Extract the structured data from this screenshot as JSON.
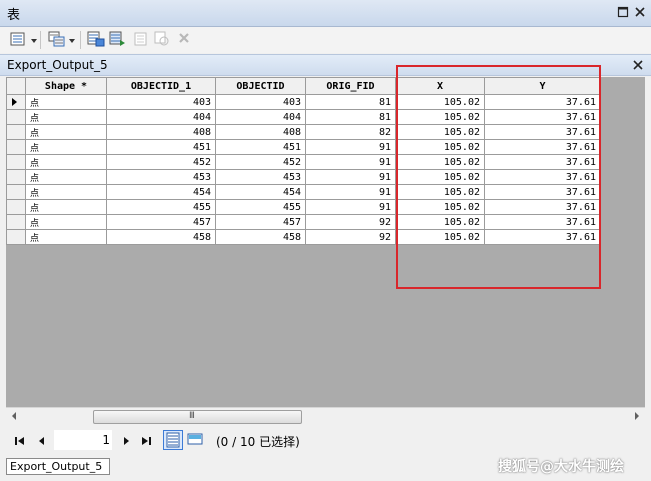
{
  "window": {
    "title": "表"
  },
  "table_tab": {
    "name": "Export_Output_5"
  },
  "table": {
    "columns": [
      "Shape *",
      "OBJECTID_1",
      "OBJECTID",
      "ORIG_FID",
      "X",
      "Y"
    ],
    "rows": [
      {
        "shape": "点",
        "objectid_1": "403",
        "objectid": "403",
        "orig_fid": "81",
        "x": "105.02",
        "y": "37.61"
      },
      {
        "shape": "点",
        "objectid_1": "404",
        "objectid": "404",
        "orig_fid": "81",
        "x": "105.02",
        "y": "37.61"
      },
      {
        "shape": "点",
        "objectid_1": "408",
        "objectid": "408",
        "orig_fid": "82",
        "x": "105.02",
        "y": "37.61"
      },
      {
        "shape": "点",
        "objectid_1": "451",
        "objectid": "451",
        "orig_fid": "91",
        "x": "105.02",
        "y": "37.61"
      },
      {
        "shape": "点",
        "objectid_1": "452",
        "objectid": "452",
        "orig_fid": "91",
        "x": "105.02",
        "y": "37.61"
      },
      {
        "shape": "点",
        "objectid_1": "453",
        "objectid": "453",
        "orig_fid": "91",
        "x": "105.02",
        "y": "37.61"
      },
      {
        "shape": "点",
        "objectid_1": "454",
        "objectid": "454",
        "orig_fid": "91",
        "x": "105.02",
        "y": "37.61"
      },
      {
        "shape": "点",
        "objectid_1": "455",
        "objectid": "455",
        "orig_fid": "91",
        "x": "105.02",
        "y": "37.61"
      },
      {
        "shape": "点",
        "objectid_1": "457",
        "objectid": "457",
        "orig_fid": "92",
        "x": "105.02",
        "y": "37.61"
      },
      {
        "shape": "点",
        "objectid_1": "458",
        "objectid": "458",
        "orig_fid": "92",
        "x": "105.02",
        "y": "37.61"
      }
    ]
  },
  "navigation": {
    "current_record": "1",
    "selection_status": "(0 / 10 已选择)"
  },
  "bottom_tab": {
    "label": "Export_Output_5"
  },
  "watermark": {
    "text": "搜狐号@大水牛测绘"
  },
  "scrollbar": {
    "grip": "III"
  },
  "icons": {
    "table_options": "table-options-icon",
    "related_tables": "related-tables-icon",
    "select_by_attributes": "select-by-attributes-icon",
    "switch_selection": "switch-selection-icon",
    "clear_selection": "clear-selection-icon",
    "zoom_to_selected": "zoom-to-selected-icon",
    "delete_selected": "delete-selected-icon"
  },
  "colors": {
    "highlight": "#d9262b",
    "title_bar": "#c9d8ec"
  }
}
